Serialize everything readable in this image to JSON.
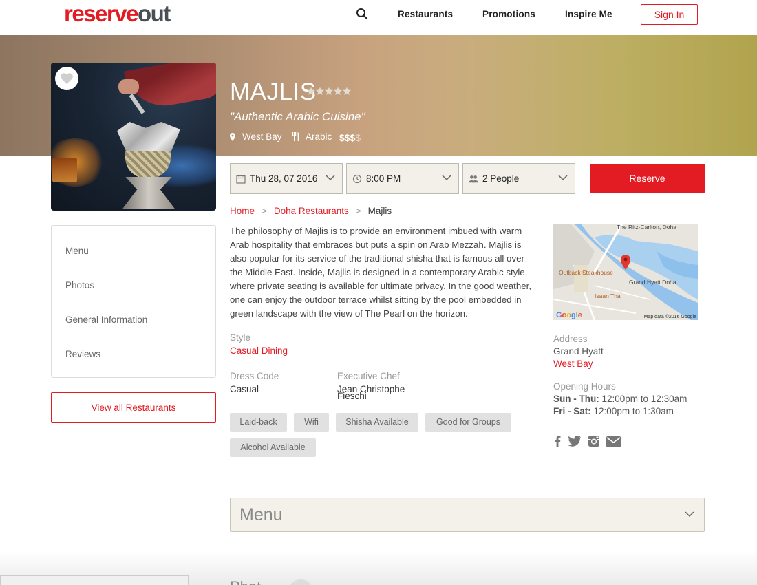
{
  "header": {
    "logo_part1": "reserve",
    "logo_part2": "out",
    "nav": [
      "Restaurants",
      "Promotions",
      "Inspire Me"
    ],
    "signin_label": "Sign In",
    "search_icon": "search-icon"
  },
  "restaurant": {
    "name": "MAJLIS",
    "rating_stars": 5,
    "tagline": "\"Authentic Arabic Cuisine\"",
    "location": "West Bay",
    "cuisine": "Arabic",
    "price_level": 3,
    "price_max": 4,
    "price_symbol": "$"
  },
  "booking": {
    "date": "Thu 28, 07 2016",
    "time": "8:00 PM",
    "people": "2 People",
    "reserve_label": "Reserve"
  },
  "sidebar": {
    "items": [
      "Menu",
      "Photos",
      "General Information",
      "Reviews"
    ],
    "view_all_label": "View all Restaurants"
  },
  "breadcrumb": {
    "home": "Home",
    "section": "Doha Restaurants",
    "current": "Majlis",
    "separator": ">"
  },
  "description": "The philosophy of Majlis is to provide an environment imbued with warm Arab hospitality that embraces but puts a spin on Arab Mezzah. Majlis is also popular for its service of the traditional shisha that is famous all over the Middle East. Inside, Majlis is designed in a contemporary Arabic style, where private seating is available for ultimate privacy. In the good weather, one can enjoy the outdoor terrace whilst sitting by the pool embedded in green landscape with the view of The Pearl on the horizon.",
  "details": {
    "style_label": "Style",
    "style_value": "Casual Dining",
    "dress_label": "Dress Code",
    "dress_value": "Casual",
    "chef_label": "Executive Chef",
    "chef_value_1": "Jean Christophe",
    "chef_value_2": "Fieschi"
  },
  "tags": [
    "Laid-back",
    "Wifi",
    "Shisha Available",
    "Good for Groups",
    "Alcohol Available"
  ],
  "map": {
    "label_top": "The Ritz-Carlton, Doha",
    "label_outback": "Outback Steakhouse",
    "label_hyatt": "Grand Hyatt Doha",
    "label_isaan": "Isaan Thai",
    "google": "Google",
    "attribution": "Map data ©2016 Google"
  },
  "address": {
    "label": "Address",
    "line1": "Grand Hyatt",
    "line2": "West Bay"
  },
  "opening": {
    "label": "Opening Hours",
    "row1_days": "Sun - Thu:",
    "row1_hours": "12:00pm to 12:30am",
    "row2_days": "Fri - Sat:",
    "row2_hours": "12:00pm to 1:30am"
  },
  "social": [
    "facebook-icon",
    "twitter-icon",
    "instagram-icon",
    "email-icon"
  ],
  "menu_section": {
    "title": "Menu"
  },
  "photos_section_peek": "Phot",
  "colors": {
    "brand_red": "#e31b23",
    "logo_grey": "#4a4f55"
  }
}
